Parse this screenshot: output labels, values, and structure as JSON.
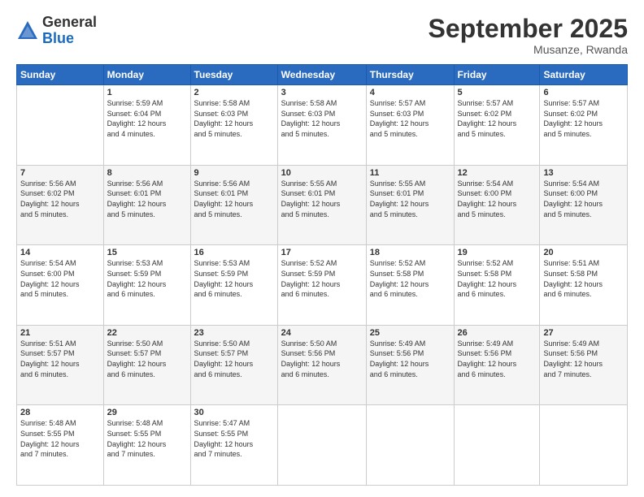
{
  "header": {
    "logo_general": "General",
    "logo_blue": "Blue",
    "title": "September 2025",
    "subtitle": "Musanze, Rwanda"
  },
  "days_of_week": [
    "Sunday",
    "Monday",
    "Tuesday",
    "Wednesday",
    "Thursday",
    "Friday",
    "Saturday"
  ],
  "weeks": [
    [
      {
        "num": "",
        "info": ""
      },
      {
        "num": "1",
        "info": "Sunrise: 5:59 AM\nSunset: 6:04 PM\nDaylight: 12 hours\nand 4 minutes."
      },
      {
        "num": "2",
        "info": "Sunrise: 5:58 AM\nSunset: 6:03 PM\nDaylight: 12 hours\nand 5 minutes."
      },
      {
        "num": "3",
        "info": "Sunrise: 5:58 AM\nSunset: 6:03 PM\nDaylight: 12 hours\nand 5 minutes."
      },
      {
        "num": "4",
        "info": "Sunrise: 5:57 AM\nSunset: 6:03 PM\nDaylight: 12 hours\nand 5 minutes."
      },
      {
        "num": "5",
        "info": "Sunrise: 5:57 AM\nSunset: 6:02 PM\nDaylight: 12 hours\nand 5 minutes."
      },
      {
        "num": "6",
        "info": "Sunrise: 5:57 AM\nSunset: 6:02 PM\nDaylight: 12 hours\nand 5 minutes."
      }
    ],
    [
      {
        "num": "7",
        "info": "Sunrise: 5:56 AM\nSunset: 6:02 PM\nDaylight: 12 hours\nand 5 minutes."
      },
      {
        "num": "8",
        "info": "Sunrise: 5:56 AM\nSunset: 6:01 PM\nDaylight: 12 hours\nand 5 minutes."
      },
      {
        "num": "9",
        "info": "Sunrise: 5:56 AM\nSunset: 6:01 PM\nDaylight: 12 hours\nand 5 minutes."
      },
      {
        "num": "10",
        "info": "Sunrise: 5:55 AM\nSunset: 6:01 PM\nDaylight: 12 hours\nand 5 minutes."
      },
      {
        "num": "11",
        "info": "Sunrise: 5:55 AM\nSunset: 6:01 PM\nDaylight: 12 hours\nand 5 minutes."
      },
      {
        "num": "12",
        "info": "Sunrise: 5:54 AM\nSunset: 6:00 PM\nDaylight: 12 hours\nand 5 minutes."
      },
      {
        "num": "13",
        "info": "Sunrise: 5:54 AM\nSunset: 6:00 PM\nDaylight: 12 hours\nand 5 minutes."
      }
    ],
    [
      {
        "num": "14",
        "info": "Sunrise: 5:54 AM\nSunset: 6:00 PM\nDaylight: 12 hours\nand 5 minutes."
      },
      {
        "num": "15",
        "info": "Sunrise: 5:53 AM\nSunset: 5:59 PM\nDaylight: 12 hours\nand 6 minutes."
      },
      {
        "num": "16",
        "info": "Sunrise: 5:53 AM\nSunset: 5:59 PM\nDaylight: 12 hours\nand 6 minutes."
      },
      {
        "num": "17",
        "info": "Sunrise: 5:52 AM\nSunset: 5:59 PM\nDaylight: 12 hours\nand 6 minutes."
      },
      {
        "num": "18",
        "info": "Sunrise: 5:52 AM\nSunset: 5:58 PM\nDaylight: 12 hours\nand 6 minutes."
      },
      {
        "num": "19",
        "info": "Sunrise: 5:52 AM\nSunset: 5:58 PM\nDaylight: 12 hours\nand 6 minutes."
      },
      {
        "num": "20",
        "info": "Sunrise: 5:51 AM\nSunset: 5:58 PM\nDaylight: 12 hours\nand 6 minutes."
      }
    ],
    [
      {
        "num": "21",
        "info": "Sunrise: 5:51 AM\nSunset: 5:57 PM\nDaylight: 12 hours\nand 6 minutes."
      },
      {
        "num": "22",
        "info": "Sunrise: 5:50 AM\nSunset: 5:57 PM\nDaylight: 12 hours\nand 6 minutes."
      },
      {
        "num": "23",
        "info": "Sunrise: 5:50 AM\nSunset: 5:57 PM\nDaylight: 12 hours\nand 6 minutes."
      },
      {
        "num": "24",
        "info": "Sunrise: 5:50 AM\nSunset: 5:56 PM\nDaylight: 12 hours\nand 6 minutes."
      },
      {
        "num": "25",
        "info": "Sunrise: 5:49 AM\nSunset: 5:56 PM\nDaylight: 12 hours\nand 6 minutes."
      },
      {
        "num": "26",
        "info": "Sunrise: 5:49 AM\nSunset: 5:56 PM\nDaylight: 12 hours\nand 6 minutes."
      },
      {
        "num": "27",
        "info": "Sunrise: 5:49 AM\nSunset: 5:56 PM\nDaylight: 12 hours\nand 7 minutes."
      }
    ],
    [
      {
        "num": "28",
        "info": "Sunrise: 5:48 AM\nSunset: 5:55 PM\nDaylight: 12 hours\nand 7 minutes."
      },
      {
        "num": "29",
        "info": "Sunrise: 5:48 AM\nSunset: 5:55 PM\nDaylight: 12 hours\nand 7 minutes."
      },
      {
        "num": "30",
        "info": "Sunrise: 5:47 AM\nSunset: 5:55 PM\nDaylight: 12 hours\nand 7 minutes."
      },
      {
        "num": "",
        "info": ""
      },
      {
        "num": "",
        "info": ""
      },
      {
        "num": "",
        "info": ""
      },
      {
        "num": "",
        "info": ""
      }
    ]
  ]
}
